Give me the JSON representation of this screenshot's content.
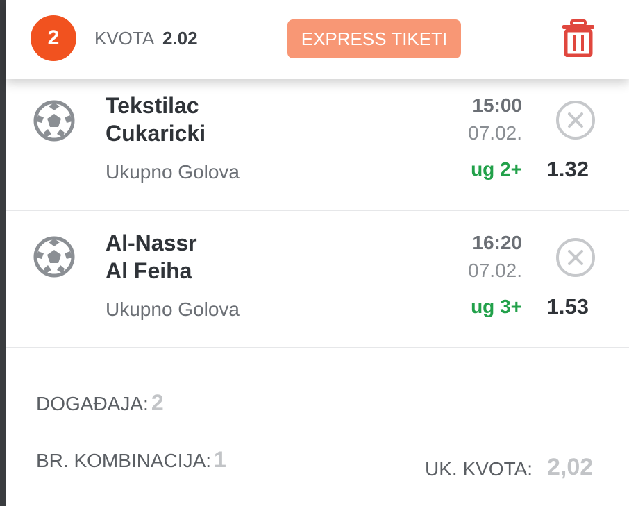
{
  "header": {
    "selection_count": "2",
    "kvota_label": "KVOTA",
    "kvota_value": "2.02",
    "express_button": "EXPRESS TIKETI",
    "trash_icon": "trash-icon"
  },
  "bets": [
    {
      "home": "Tekstilac",
      "away": "Cukaricki",
      "market": "Ukupno Golova",
      "time": "15:00",
      "date": "07.02.",
      "pick": "ug 2+",
      "odd": "1.32",
      "sport_icon": "soccer-ball-icon",
      "remove_icon": "close-circle-icon"
    },
    {
      "home": "Al-Nassr",
      "away": "Al Feiha",
      "market": "Ukupno Golova",
      "time": "16:20",
      "date": "07.02.",
      "pick": "ug 3+",
      "odd": "1.53",
      "sport_icon": "soccer-ball-icon",
      "remove_icon": "close-circle-icon"
    }
  ],
  "summary": {
    "events_label": "DOGAĐAJA:",
    "events_value": "2",
    "combinations_label": "BR. KOMBINACIJA:",
    "combinations_value": "1",
    "total_odds_label": "UK. KVOTA:",
    "total_odds_value": "2,02"
  },
  "colors": {
    "accent": "#f1521f",
    "express_button": "#f89775",
    "pick_green": "#22a14a",
    "trash_red": "#e0473e"
  }
}
